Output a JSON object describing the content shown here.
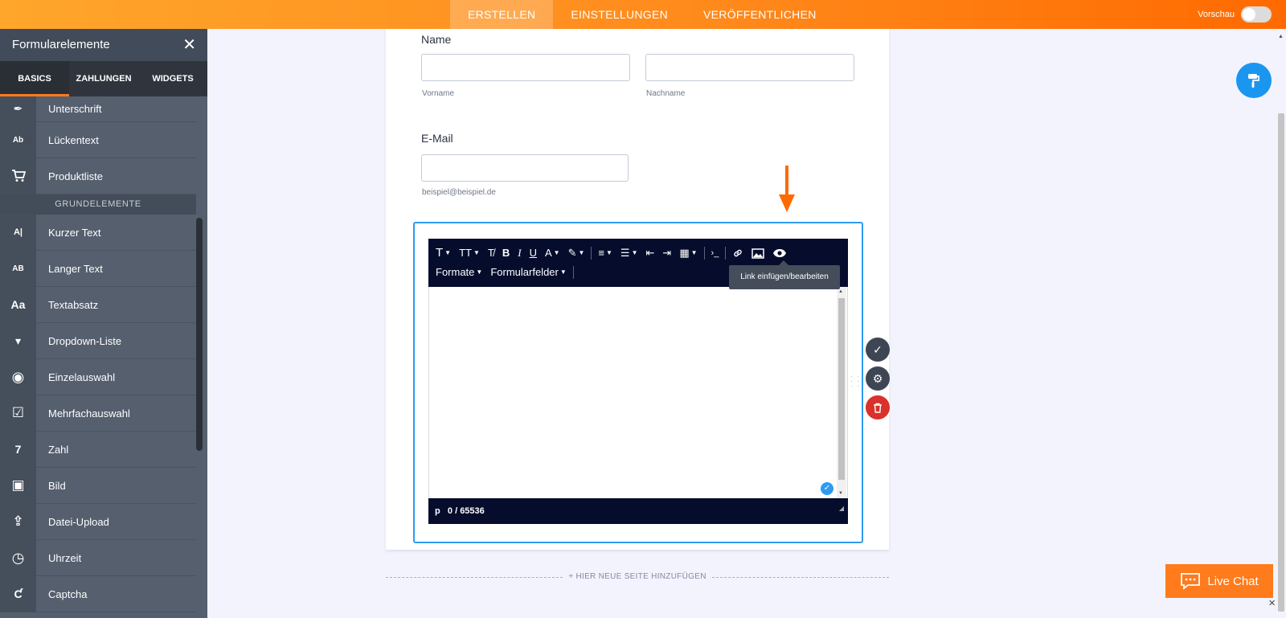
{
  "topbar": {
    "tabs": [
      {
        "label": "ERSTELLEN",
        "active": true
      },
      {
        "label": "EINSTELLUNGEN",
        "active": false
      },
      {
        "label": "VERÖFFENTLICHEN",
        "active": false
      }
    ],
    "preview_label": "Vorschau"
  },
  "sidebar": {
    "title": "Formularelemente",
    "close": "✕",
    "tabs": [
      "BASICS",
      "ZAHLUNGEN",
      "WIDGETS"
    ],
    "items_top": [
      {
        "icon": "signature-icon",
        "glyph": "✒",
        "label": "Unterschrift"
      },
      {
        "icon": "fill-blank-icon",
        "glyph": "Ab",
        "label": "Lückentext"
      },
      {
        "icon": "cart-icon",
        "glyph": "🛒",
        "label": "Produktliste"
      }
    ],
    "section_label": "GRUNDELEMENTE",
    "items": [
      {
        "icon": "short-text-icon",
        "glyph": "A|",
        "label": "Kurzer Text"
      },
      {
        "icon": "long-text-icon",
        "glyph": "AB",
        "label": "Langer Text"
      },
      {
        "icon": "paragraph-icon",
        "glyph": "Aa",
        "label": "Textabsatz"
      },
      {
        "icon": "dropdown-icon",
        "glyph": "▾",
        "label": "Dropdown-Liste"
      },
      {
        "icon": "radio-icon",
        "glyph": "◉",
        "label": "Einzelauswahl"
      },
      {
        "icon": "checkbox-icon",
        "glyph": "☑",
        "label": "Mehrfachauswahl"
      },
      {
        "icon": "number-icon",
        "glyph": "7",
        "label": "Zahl"
      },
      {
        "icon": "image-icon",
        "glyph": "▣",
        "label": "Bild"
      },
      {
        "icon": "upload-icon",
        "glyph": "⇪",
        "label": "Datei-Upload"
      },
      {
        "icon": "clock-icon",
        "glyph": "◷",
        "label": "Uhrzeit"
      },
      {
        "icon": "captcha-icon",
        "glyph": "Ƈ",
        "label": "Captcha"
      }
    ]
  },
  "form": {
    "name_label": "Name",
    "first_name_sublabel": "Vorname",
    "last_name_sublabel": "Nachname",
    "email_label": "E-Mail",
    "email_sublabel": "beispiel@beispiel.de"
  },
  "editor": {
    "row1": [
      "T",
      "TT",
      "T̸",
      "B",
      "I",
      "U",
      "A",
      "✎",
      "≡",
      "☰",
      "⇤",
      "⇥",
      "▦",
      "›_",
      "🔗",
      "▨",
      "👁"
    ],
    "formats_label": "Formate",
    "fields_label": "Formularfelder",
    "tooltip": "Link einfügen/bearbeiten",
    "status_tag": "p",
    "status_count": "0 / 65536"
  },
  "add_page_label": "+ HIER NEUE SEITE HINZUFÜGEN",
  "livechat_label": "Live Chat",
  "colors": {
    "accent": "#ff7b1c",
    "selection": "#2e9bf0",
    "toolbar": "#050c2c",
    "delete": "#d9312b"
  }
}
